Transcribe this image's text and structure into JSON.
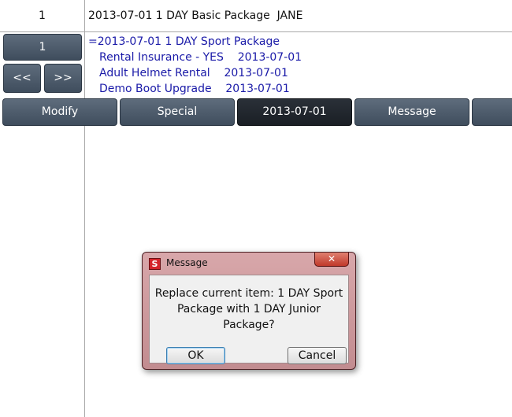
{
  "row1": {
    "number": "1",
    "description": "2013-07-01 1 DAY Basic Package  JANE"
  },
  "nav": {
    "number_label": "1",
    "prev_label": "<<",
    "next_label": ">>"
  },
  "detail": {
    "main": "=2013-07-01 1 DAY Sport Package",
    "items": [
      "Rental Insurance - YES    2013-07-01",
      "Adult Helmet Rental    2013-07-01",
      "Demo Boot Upgrade    2013-07-01"
    ]
  },
  "toolbar": {
    "modify": "Modify",
    "special": "Special",
    "date": "2013-07-01",
    "message": "Message",
    "more": ""
  },
  "dialog": {
    "logo": "S",
    "title": "Message",
    "close": "✕",
    "message_lines": [
      "Replace current item: 1 DAY Sport",
      "Package with 1 DAY Junior",
      "Package?"
    ],
    "ok": "OK",
    "cancel": "Cancel"
  }
}
